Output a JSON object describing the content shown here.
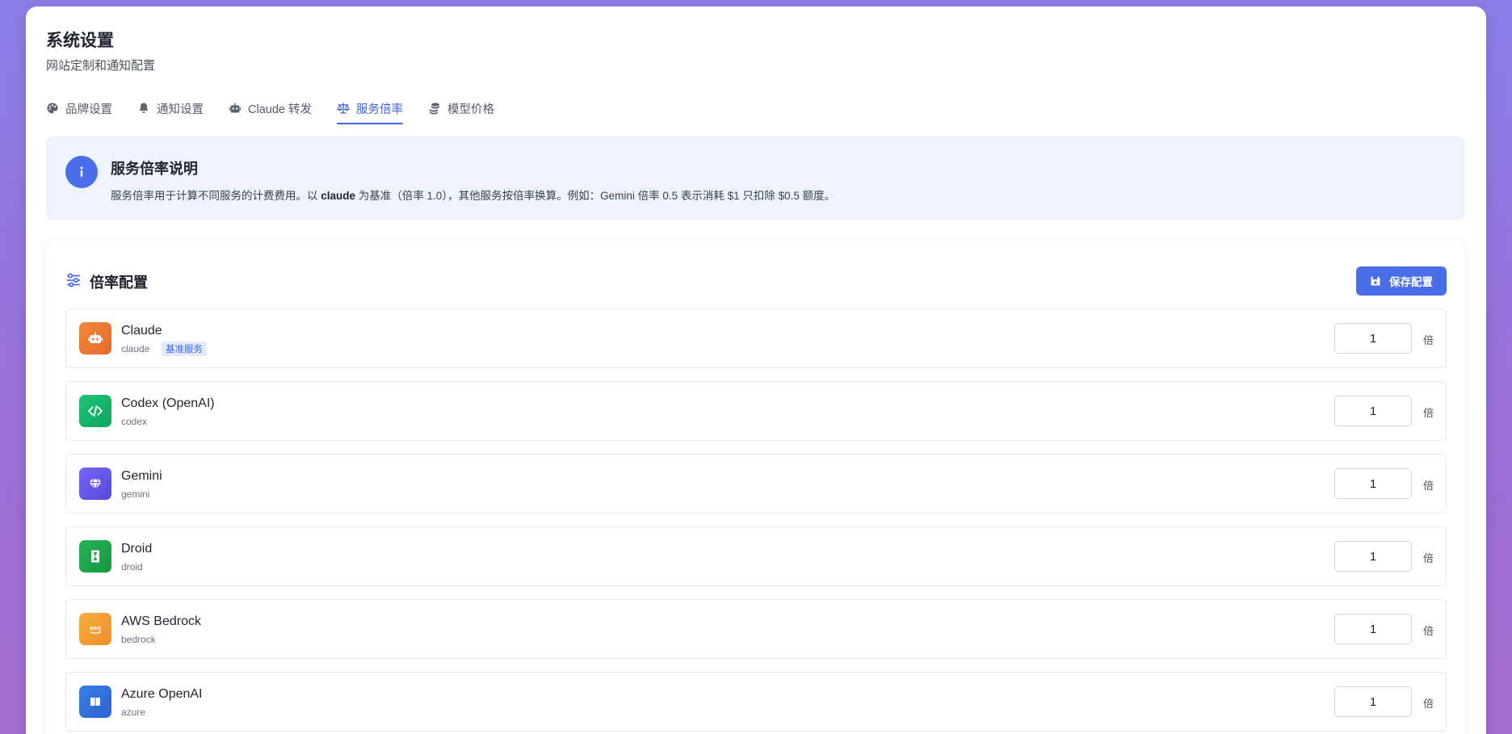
{
  "page": {
    "title": "系统设置",
    "subtitle": "网站定制和通知配置"
  },
  "tabs": [
    {
      "label": "品牌设置",
      "icon": "palette-icon",
      "active": false
    },
    {
      "label": "通知设置",
      "icon": "bell-icon",
      "active": false
    },
    {
      "label": "Claude 转发",
      "icon": "robot-icon",
      "active": false
    },
    {
      "label": "服务倍率",
      "icon": "scale-icon",
      "active": true
    },
    {
      "label": "模型价格",
      "icon": "coins-icon",
      "active": false
    }
  ],
  "info": {
    "title": "服务倍率说明",
    "text_before": "服务倍率用于计算不同服务的计费费用。以 ",
    "text_bold": "claude",
    "text_after": " 为基准（倍率 1.0），其他服务按倍率换算。例如：Gemini 倍率 0.5 表示消耗 $1 只扣除 $0.5 额度。"
  },
  "config": {
    "title": "倍率配置",
    "save_label": "保存配置",
    "unit": "倍",
    "services": [
      {
        "name": "Claude",
        "id": "claude",
        "badge": "基准服务",
        "rate": "1",
        "icon": "robot-icon",
        "color": "#ef7b2a"
      },
      {
        "name": "Codex (OpenAI)",
        "id": "codex",
        "badge": "",
        "rate": "1",
        "icon": "code-icon",
        "color": "#16b36a"
      },
      {
        "name": "Gemini",
        "id": "gemini",
        "badge": "",
        "rate": "1",
        "icon": "gem-icon",
        "color": "#6a5cf0"
      },
      {
        "name": "Droid",
        "id": "droid",
        "badge": "",
        "rate": "1",
        "icon": "hourglass-icon",
        "color": "#1ea64a"
      },
      {
        "name": "AWS Bedrock",
        "id": "bedrock",
        "badge": "",
        "rate": "1",
        "icon": "aws-icon",
        "color": "#f2a23a"
      },
      {
        "name": "Azure OpenAI",
        "id": "azure",
        "badge": "",
        "rate": "1",
        "icon": "windows-icon",
        "color": "#2f6fd9"
      }
    ]
  }
}
